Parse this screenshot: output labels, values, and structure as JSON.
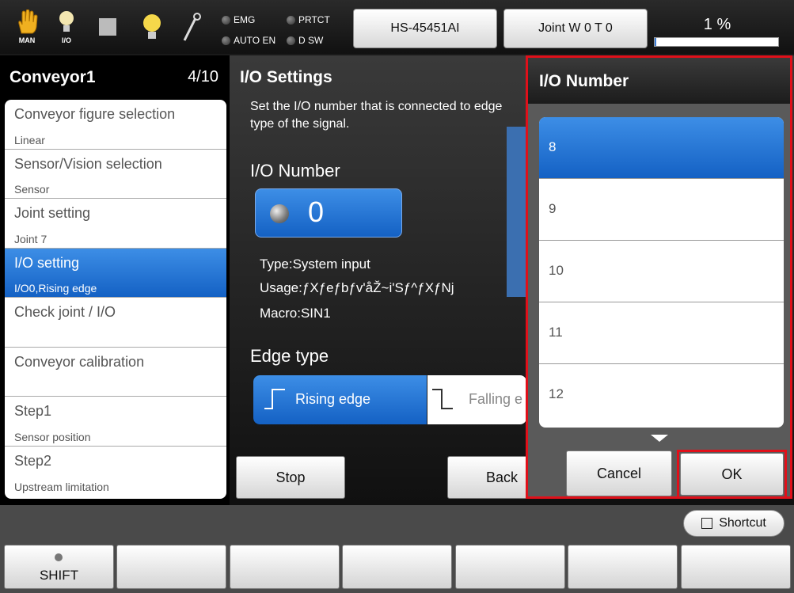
{
  "topbar": {
    "icons": [
      {
        "name": "hand-icon",
        "label": "MAN"
      },
      {
        "name": "bulb-icon",
        "label": "I/O"
      },
      {
        "name": "square-icon",
        "label": ""
      },
      {
        "name": "bulb-icon",
        "label": ""
      },
      {
        "name": "wrench-icon",
        "label": ""
      }
    ],
    "status": {
      "emg": "EMG",
      "prtct": "PRTCT",
      "auto_en": "AUTO EN",
      "d_sw": "D SW"
    },
    "robot_model": "HS-45451AI",
    "coord_mode": "Joint  W 0 T 0",
    "speed_percent": "1 %",
    "speed_fraction": 0.01
  },
  "sidebar": {
    "title": "Conveyor1",
    "count": "4/10",
    "items": [
      {
        "title": "Conveyor figure selection",
        "sub": "Linear"
      },
      {
        "title": "Sensor/Vision selection",
        "sub": "Sensor"
      },
      {
        "title": "Joint setting",
        "sub": "Joint 7"
      },
      {
        "title": "I/O setting",
        "sub": "I/O0,Rising edge"
      },
      {
        "title": "Check joint / I/O",
        "sub": ""
      },
      {
        "title": "Conveyor calibration",
        "sub": ""
      },
      {
        "title": "Step1",
        "sub": "Sensor position"
      },
      {
        "title": "Step2",
        "sub": "Upstream limitation"
      }
    ]
  },
  "main": {
    "title": "I/O Settings",
    "description": "Set the I/O number that is connected to edge type of the signal.",
    "io_number_label": "I/O Number",
    "io_value": "0",
    "type": "Type:System input",
    "usage": "Usage:ƒXƒeƒbƒv'åŽ~i'Sƒ^ƒXƒNj",
    "macro": "Macro:SIN1",
    "edge_label": "Edge type",
    "edge_rising": "Rising edge",
    "edge_falling": "Falling e",
    "stop_button": "Stop",
    "back_button": "Back"
  },
  "dialog": {
    "title": "I/O Number",
    "options": [
      "8",
      "9",
      "10",
      "11",
      "12"
    ],
    "cancel": "Cancel",
    "ok": "OK"
  },
  "bottom": {
    "shortcut": "Shortcut",
    "shift": "SHIFT"
  }
}
